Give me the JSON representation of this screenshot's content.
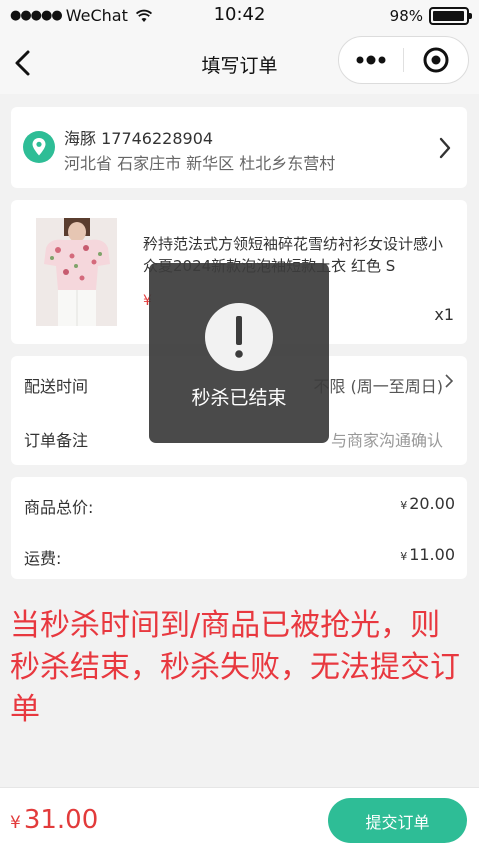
{
  "status_bar": {
    "carrier": "WeChat",
    "time": "10:42",
    "battery": "98%",
    "battery_level": 0.98
  },
  "nav": {
    "title": "填写订单"
  },
  "address": {
    "name_phone": "海豚 17746228904",
    "detail": "河北省 石家庄市 新华区 杜北乡东营村"
  },
  "product": {
    "title": "矜持范法式方领短袖碎花雪纺衬衫女设计感小众夏2024新款泡泡袖短款上衣 红色 S",
    "price_prefix": "¥",
    "quantity": "x1"
  },
  "options": {
    "delivery_label": "配送时间",
    "delivery_value": "不限 (周一至周日)",
    "remark_label": "订单备注",
    "remark_value": "与商家沟通确认"
  },
  "price": {
    "goods_label": "商品总价:",
    "goods_value": "20.00",
    "shipping_label": "运费:",
    "shipping_value": "11.00",
    "currency": "¥"
  },
  "annotation": "当秒杀时间到/商品已被抢光，则秒杀结束，秒杀失败，无法提交订单",
  "bottom": {
    "currency": "¥",
    "total": "31.00",
    "submit_label": "提交订单"
  },
  "toast": {
    "message": "秒杀已结束",
    "icon": "exclamation-icon"
  },
  "colors": {
    "accent": "#2ebd96",
    "price": "#e23b3b",
    "annotation": "#e8383f"
  }
}
